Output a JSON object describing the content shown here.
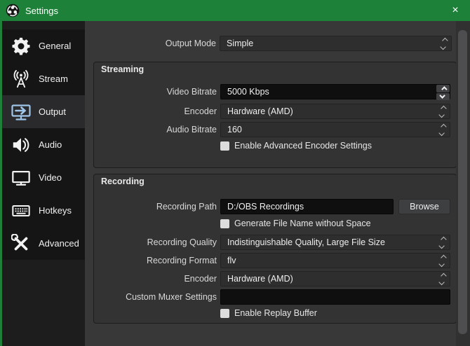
{
  "window": {
    "title": "Settings",
    "close": "×"
  },
  "sidebar": {
    "items": [
      {
        "label": "General",
        "icon": "gear-icon",
        "selected": false
      },
      {
        "label": "Stream",
        "icon": "broadcast-icon",
        "selected": false
      },
      {
        "label": "Output",
        "icon": "output-monitor-icon",
        "selected": true
      },
      {
        "label": "Audio",
        "icon": "speaker-icon",
        "selected": false
      },
      {
        "label": "Video",
        "icon": "monitor-icon",
        "selected": false
      },
      {
        "label": "Hotkeys",
        "icon": "keyboard-icon",
        "selected": false
      },
      {
        "label": "Advanced",
        "icon": "tools-icon",
        "selected": false
      }
    ]
  },
  "output_mode": {
    "label": "Output Mode",
    "value": "Simple"
  },
  "streaming": {
    "title": "Streaming",
    "video_bitrate": {
      "label": "Video Bitrate",
      "value": "5000 Kbps"
    },
    "encoder": {
      "label": "Encoder",
      "value": "Hardware (AMD)"
    },
    "audio_bitrate": {
      "label": "Audio Bitrate",
      "value": "160"
    },
    "advanced_encoder_checkbox": {
      "label": "Enable Advanced Encoder Settings",
      "checked": false
    }
  },
  "recording": {
    "title": "Recording",
    "path": {
      "label": "Recording Path",
      "value": "D:/OBS Recordings"
    },
    "browse_button": "Browse",
    "no_space_checkbox": {
      "label": "Generate File Name without Space",
      "checked": false
    },
    "quality": {
      "label": "Recording Quality",
      "value": "Indistinguishable Quality, Large File Size"
    },
    "format": {
      "label": "Recording Format",
      "value": "flv"
    },
    "encoder": {
      "label": "Encoder",
      "value": "Hardware (AMD)"
    },
    "muxer": {
      "label": "Custom Muxer Settings",
      "value": ""
    },
    "replay_checkbox": {
      "label": "Enable Replay Buffer",
      "checked": false
    }
  },
  "colors": {
    "titlebar_green": "#1e8139",
    "selected_icon_blue": "#9fc5e8",
    "focused_field_bg": "#0f0f10"
  }
}
